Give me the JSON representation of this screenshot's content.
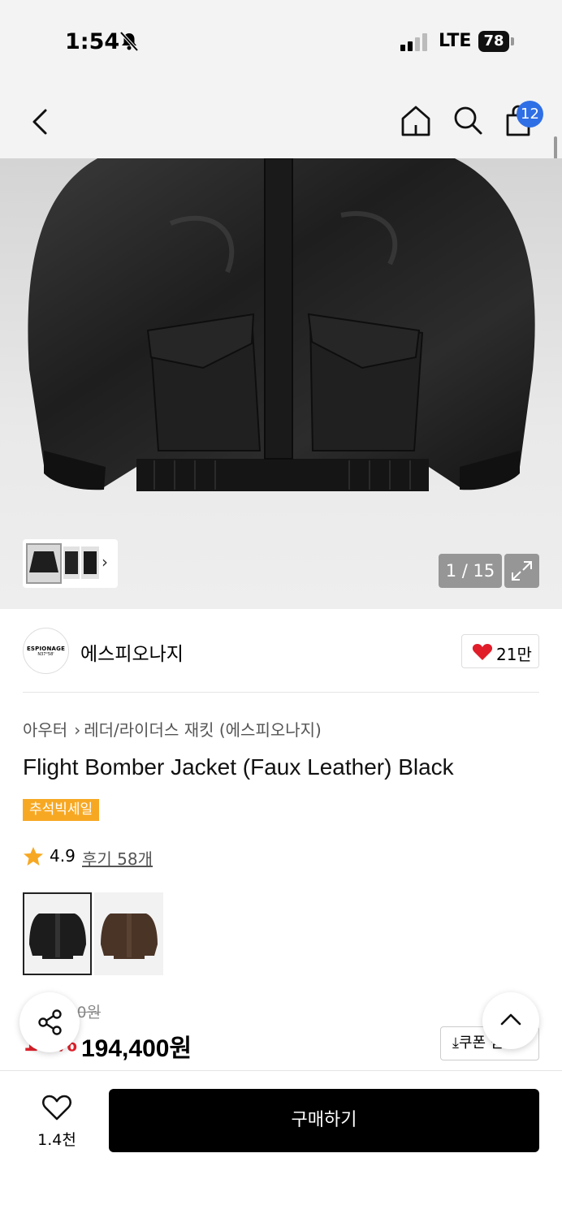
{
  "status_bar": {
    "time": "1:54",
    "network": "LTE",
    "battery": "78"
  },
  "header": {
    "cart_count": "12"
  },
  "gallery": {
    "counter": "1 / 15"
  },
  "brand": {
    "logo_line1": "ESPIONAGE",
    "logo_line2": "N37°58'",
    "name": "에스피오나지",
    "likes": "21만"
  },
  "product": {
    "breadcrumb_category": "아우터",
    "breadcrumb_sub": "레더/라이더스 재킷 (에스피오나지)",
    "title": "Flight Bomber Jacket (Faux Leather) Black",
    "sale_tag": "추석빅세일",
    "rating": "4.9",
    "reviews": "후기 58개",
    "colors": [
      {
        "name": "black",
        "hex": "#1c1c1c"
      },
      {
        "name": "brown",
        "hex": "#4a3426"
      }
    ],
    "original_price": "216,000원",
    "discount": "10%",
    "price": "194,400원",
    "coupon_label": "쿠폰 받기"
  },
  "bottom_bar": {
    "wish_count": "1.4천",
    "buy_label": "구매하기"
  },
  "colors": {
    "accent_blue": "#2f6fe6",
    "sale_orange": "#f7a823",
    "discount_red": "#e0202b",
    "heart_red": "#e11d2a"
  }
}
